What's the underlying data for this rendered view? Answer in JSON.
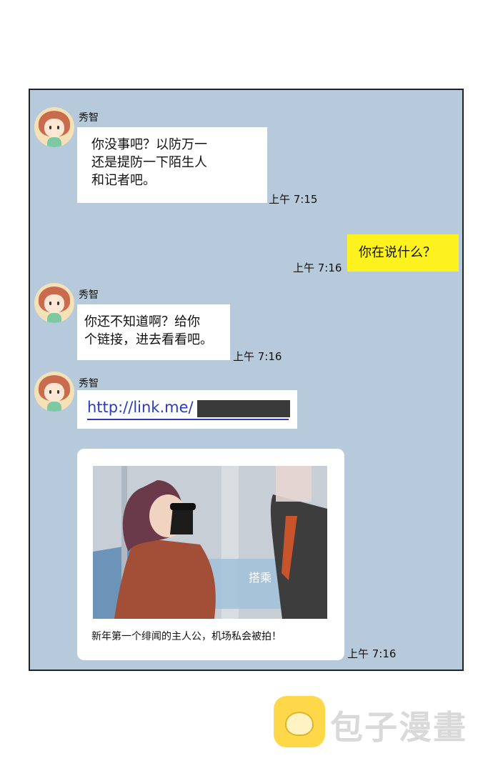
{
  "messages": [
    {
      "sender": "秀智",
      "text": "你没事吧？以防万一\n还是提防一下陌生人\n和记者吧。",
      "time": "上午 7:15"
    },
    {
      "me": true,
      "text": "你在说什么？",
      "time": "上午 7:16"
    },
    {
      "sender": "秀智",
      "text": "你还不知道啊？给你\n个链接，进去看看吧。",
      "time": "上午 7:16"
    },
    {
      "sender": "秀智",
      "link": "http://link.me/"
    },
    {
      "card_caption": "新年第一个绯闻的主人公，机场私会被拍！",
      "time": "上午 7:16",
      "image_text": "搭乘"
    }
  ],
  "watermark": {
    "text": "包子漫畫"
  },
  "colors": {
    "chat_bg": "#b7cadb",
    "my_bubble": "#fdf21d",
    "link": "#2a3bbd"
  }
}
